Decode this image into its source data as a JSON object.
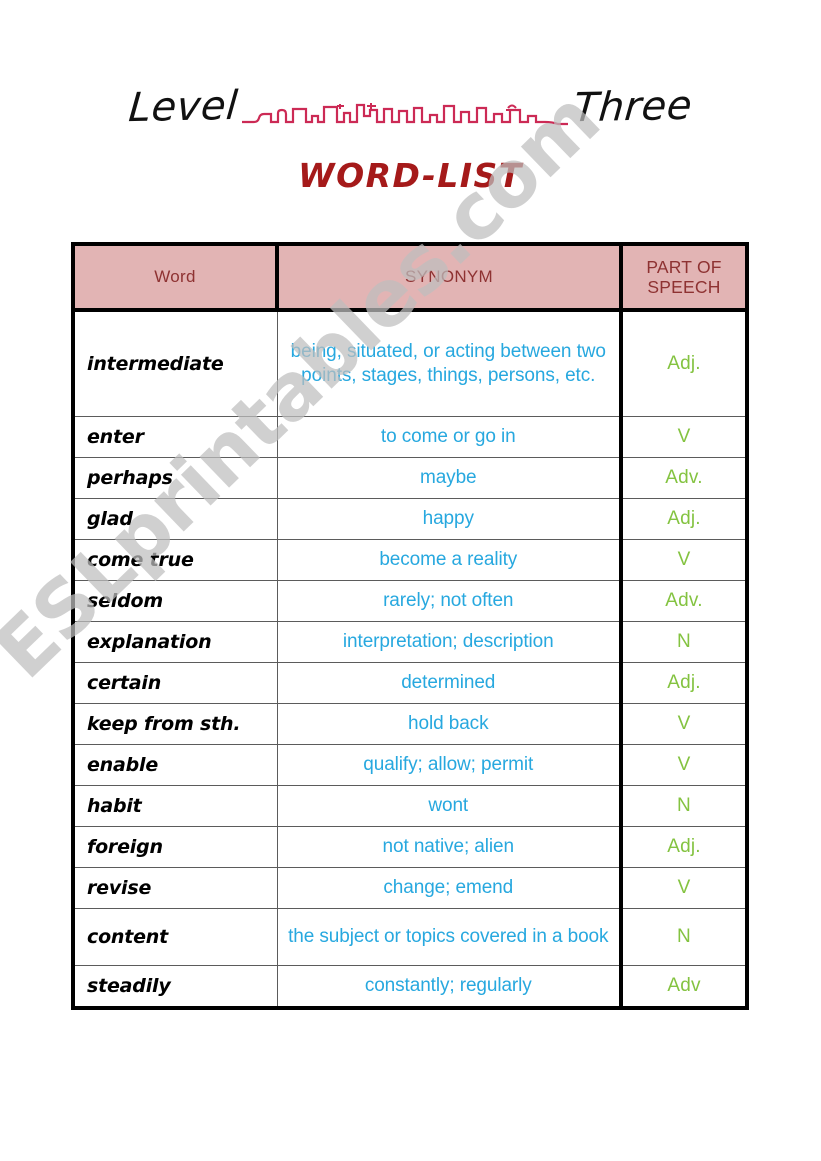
{
  "header": {
    "level_prefix": "Level",
    "level_suffix": "Three",
    "divider_icon": "skyline-squiggle-divider",
    "subtitle": "WORD-LIST"
  },
  "colors": {
    "header_fill": "#E2B4B4",
    "header_text": "#8E3232",
    "title_red": "#A51A1A",
    "synonym_blue": "#27A8DF",
    "pos_green": "#84C341",
    "word_black": "#000000",
    "divider_crimson": "#CC2A55",
    "watermark_gray": "#BFBFBF",
    "table_border": "#000000",
    "row_rule": "#5B5B5B"
  },
  "watermark": {
    "text": "ESLprintables.com"
  },
  "table": {
    "columns": [
      {
        "key": "word",
        "label": "Word"
      },
      {
        "key": "synonym",
        "label": "SYNONYM"
      },
      {
        "key": "pos",
        "label": "PART OF SPEECH",
        "label_line1": "PART OF",
        "label_line2": "SPEECH"
      }
    ],
    "rows": [
      {
        "word": "intermediate",
        "synonym": "being, situated, or acting between two points, stages, things, persons, etc.",
        "pos": "Adj.",
        "size": "tall"
      },
      {
        "word": "enter",
        "synonym": "to come or go in",
        "pos": "V",
        "size": "std"
      },
      {
        "word": "perhaps",
        "synonym": "maybe",
        "pos": "Adv.",
        "size": "std"
      },
      {
        "word": "glad",
        "synonym": "happy",
        "pos": "Adj.",
        "size": "std"
      },
      {
        "word": "come true",
        "synonym": "become a reality",
        "pos": "V",
        "size": "std"
      },
      {
        "word": "seldom",
        "synonym": "rarely; not often",
        "pos": "Adv.",
        "size": "std"
      },
      {
        "word": "explanation",
        "synonym": "interpretation; description",
        "pos": "N",
        "size": "std"
      },
      {
        "word": "certain",
        "synonym": "determined",
        "pos": "Adj.",
        "size": "std"
      },
      {
        "word": "keep from sth.",
        "synonym": "hold back",
        "pos": "V",
        "size": "std"
      },
      {
        "word": "enable",
        "synonym": "qualify; allow; permit",
        "pos": "V",
        "size": "std"
      },
      {
        "word": "habit",
        "synonym": "wont",
        "pos": "N",
        "size": "std"
      },
      {
        "word": "foreign",
        "synonym": "not native; alien",
        "pos": "Adj.",
        "size": "std"
      },
      {
        "word": "revise",
        "synonym": "change; emend",
        "pos": "V",
        "size": "std"
      },
      {
        "word": "content",
        "synonym": "the subject or topics covered in a book",
        "pos": "N",
        "size": "mid"
      },
      {
        "word": "steadily",
        "synonym": "constantly; regularly",
        "pos": "Adv",
        "size": "std"
      }
    ]
  }
}
